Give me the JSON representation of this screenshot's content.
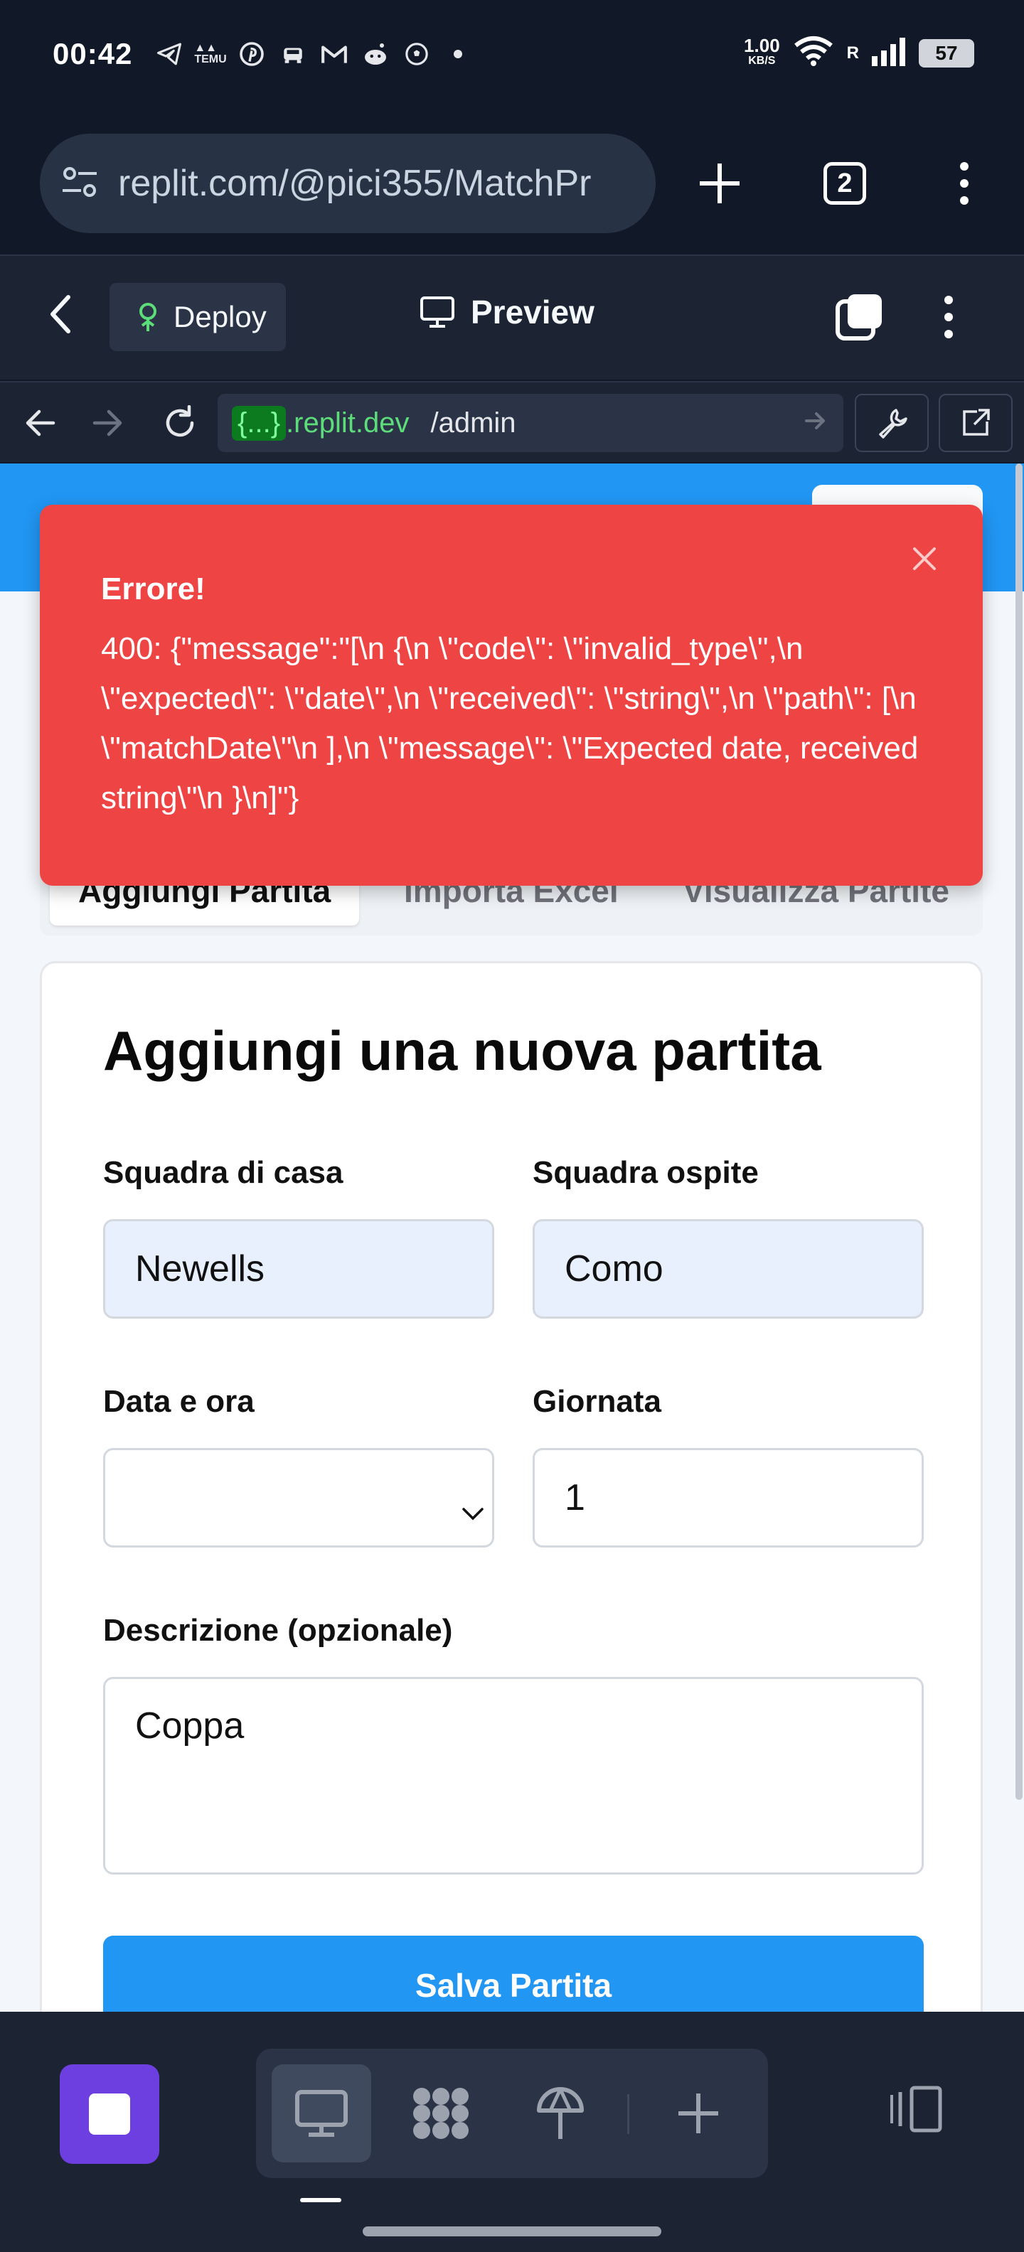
{
  "status_bar": {
    "time": "00:42",
    "app_icons": [
      "telegram-icon",
      "temu-icon",
      "pinterest-icon",
      "car-icon",
      "gmail-icon",
      "reddit-icon",
      "football-icon"
    ],
    "net_speed_value": "1.00",
    "net_speed_unit": "KB/S",
    "roaming": "R",
    "battery": "57"
  },
  "browser": {
    "url": "replit.com/@pici355/MatchPr",
    "tab_count": "2"
  },
  "replit_header": {
    "deploy_label": "Deploy",
    "preview_label": "Preview"
  },
  "webview_nav": {
    "address_highlight": "{...}",
    "address_domain": ".replit.dev",
    "address_path": "/admin"
  },
  "tabs": [
    {
      "label": "Aggiungi Partita",
      "active": true
    },
    {
      "label": "Importa Excel",
      "active": false
    },
    {
      "label": "Visualizza Partite",
      "active": false
    }
  ],
  "form": {
    "title": "Aggiungi una nuova partita",
    "home_team_label": "Squadra di casa",
    "home_team_value": "Newells",
    "away_team_label": "Squadra ospite",
    "away_team_value": "Como",
    "datetime_label": "Data e ora",
    "datetime_value": "",
    "matchday_label": "Giornata",
    "matchday_value": "1",
    "description_label": "Descrizione (opzionale)",
    "description_value": "Coppa",
    "save_label": "Salva Partita"
  },
  "toast": {
    "title": "Errore!",
    "message": "400: {\"message\":\"[\\n {\\n \\\"code\\\": \\\"invalid_type\\\",\\n \\\"expected\\\": \\\"date\\\",\\n \\\"received\\\": \\\"string\\\",\\n \\\"path\\\": [\\n \\\"matchDate\\\"\\n ],\\n \\\"message\\\": \\\"Expected date, received string\\\"\\n }\\n]\"}"
  },
  "colors": {
    "accent": "#2196f3",
    "error": "#ef4444",
    "replit_dark": "#1c2333",
    "stop_purple": "#6d3ee0"
  }
}
